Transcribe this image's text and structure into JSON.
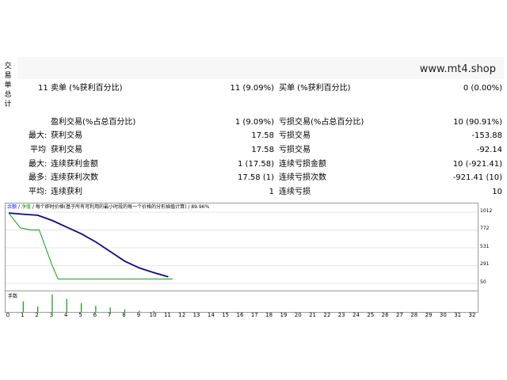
{
  "side_tab": {
    "chars": [
      "交",
      "易",
      "单",
      "总",
      "计"
    ]
  },
  "brand": "www.mt4.shop",
  "stats": {
    "row1": {
      "left_count": "11",
      "left_label": "卖单 (%获利百分比)",
      "left_value": "11 (9.09%)",
      "right_label": "买单 (%获利百分比)",
      "right_value": "0 (0.00%)"
    },
    "row2": {
      "left_label": "盈利交易(%占总百分比)",
      "left_value": "1 (9.09%)",
      "right_label": "亏损交易(%占总百分比)",
      "right_value": "10 (90.91%)"
    },
    "row3": {
      "prefix": "最大:",
      "left_label": "获利交易",
      "left_value": "17.58",
      "right_label": "亏损交易",
      "right_value": "-153.88"
    },
    "row4": {
      "prefix": "平均",
      "left_label": "获利交易",
      "left_value": "17.58",
      "right_label": "亏损交易",
      "right_value": "-92.14"
    },
    "row5": {
      "prefix": "最大:",
      "left_label": "连续获利金额",
      "left_value": "1 (17.58)",
      "right_label": "连续亏损金额",
      "right_value": "10 (-921.41)"
    },
    "row6": {
      "prefix": "最多:",
      "left_label": "连续获利次数",
      "left_value": "17.58 (1)",
      "right_label": "连续亏损次数",
      "right_value": "-921.41 (10)"
    },
    "row7": {
      "prefix": "平均:",
      "left_label": "连续获利",
      "left_value": "1",
      "right_label": "连续亏损",
      "right_value": "10"
    }
  },
  "chart": {
    "legend_blue": "余额",
    "legend_sep1": "/",
    "legend_green": "净值",
    "legend_rest": "/ 每个即时价格(基于所有可利用的最小时段的每一个价格的分形插值计算) / 89.96%",
    "volume_label": "手数"
  },
  "chart_data": {
    "type": "line",
    "y_ticks": [
      "1012",
      "772",
      "531",
      "291",
      "50"
    ],
    "ylim": [
      50,
      1012
    ],
    "x_ticks": [
      "0",
      "1",
      "2",
      "3",
      "4",
      "5",
      "6",
      "7",
      "8",
      "9",
      "10",
      "11",
      "12",
      "13",
      "14",
      "15",
      "16",
      "17",
      "18",
      "19",
      "20",
      "21",
      "22",
      "23",
      "24",
      "25",
      "26",
      "27",
      "28",
      "29",
      "30",
      "31",
      "32"
    ],
    "xlim": [
      0,
      32
    ],
    "colors": {
      "balance": "#0b0b8c",
      "equity": "#00a000",
      "volume": "#00a000"
    },
    "series": [
      {
        "name": "余额",
        "x": [
          0,
          1,
          2,
          3,
          4,
          5,
          6,
          7,
          8,
          9,
          10,
          11
        ],
        "y": [
          1000,
          984,
          970,
          900,
          810,
          720,
          610,
          480,
          350,
          260,
          195,
          140
        ]
      },
      {
        "name": "净值",
        "x": [
          0,
          0.8,
          1.5,
          2.1,
          3.0,
          3.4,
          11.3
        ],
        "y": [
          1000,
          800,
          772,
          772,
          290,
          110,
          110
        ]
      }
    ],
    "volume_bars": {
      "x": [
        1,
        2,
        3,
        4,
        5,
        6,
        7,
        8,
        9,
        10
      ],
      "y": [
        0.6,
        0.3,
        1.0,
        0.75,
        0.5,
        0.35,
        0.25,
        0.15,
        0.08,
        0.05
      ]
    }
  }
}
